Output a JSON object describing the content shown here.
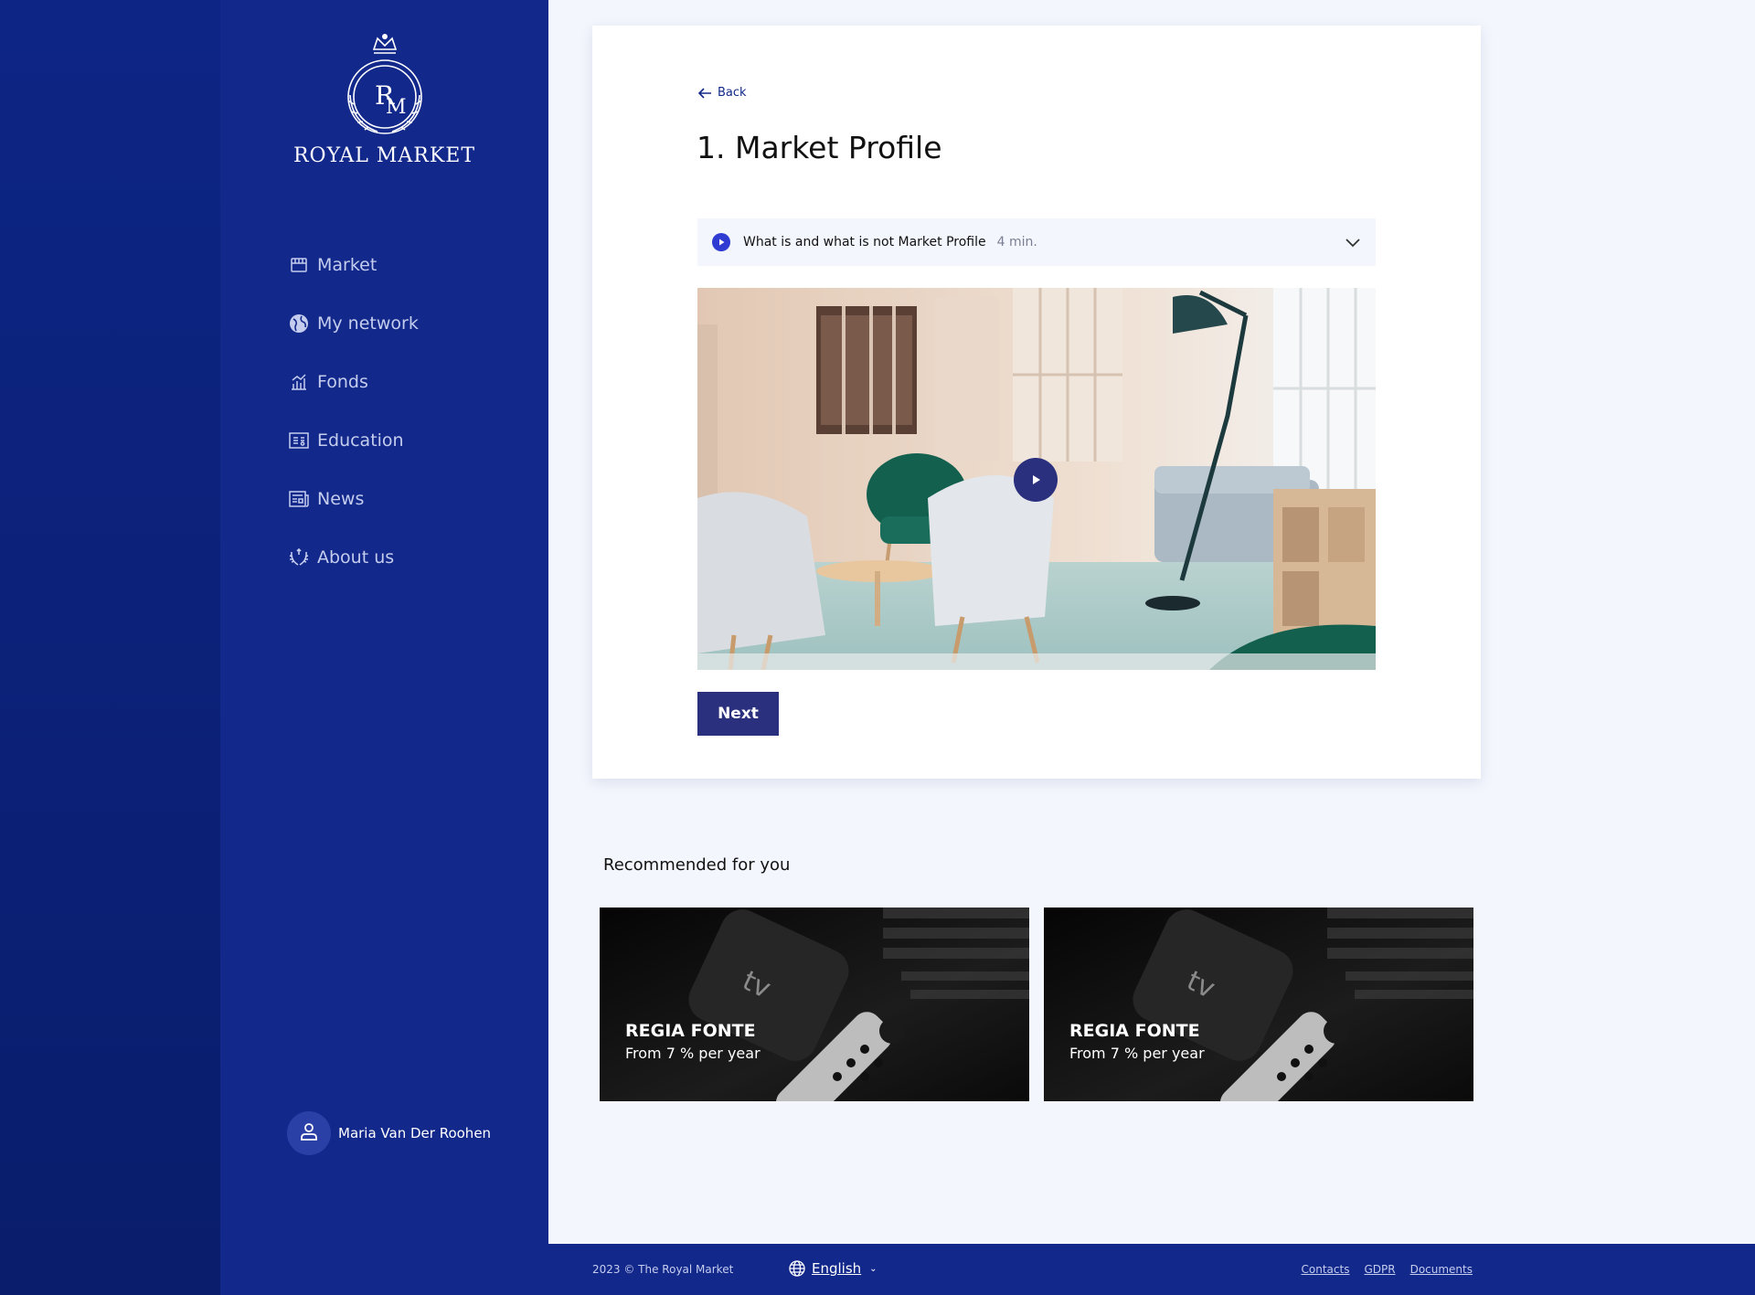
{
  "brand": {
    "name": "ROYAL MARKET",
    "monogram_r": "R",
    "monogram_m": "M"
  },
  "sidebar": {
    "items": [
      {
        "label": "Market",
        "icon": "store-icon"
      },
      {
        "label": "My network",
        "icon": "globe-icon"
      },
      {
        "label": "Fonds",
        "icon": "chart-icon"
      },
      {
        "label": "Education",
        "icon": "certificate-icon"
      },
      {
        "label": "News",
        "icon": "newspaper-icon"
      },
      {
        "label": "About us",
        "icon": "laurel-icon"
      }
    ],
    "user": {
      "name": "Maria Van Der Roohen",
      "icon": "user-icon"
    }
  },
  "main": {
    "back_label": "Back",
    "title": "1. Market Profile",
    "lesson": {
      "title": "What is and what is not Market Profile",
      "duration": "4 min."
    },
    "next_label": "Next"
  },
  "recommended": {
    "title": "Recommended for you",
    "cards": [
      {
        "name": "REGIA FONTE",
        "subtitle": "From 7 % per year",
        "logo_text": "tv"
      },
      {
        "name": "REGIA FONTE",
        "subtitle": "From 7 % per year",
        "logo_text": "tv"
      }
    ]
  },
  "footer": {
    "copyright": "2023 © The Royal Market",
    "language": "English",
    "links": [
      "Contacts",
      "GDPR",
      "Documents"
    ]
  },
  "colors": {
    "primary": "#12288a",
    "button": "#2a2f7e",
    "lesson_play": "#2f3bd1",
    "background": "#f3f6fd"
  }
}
